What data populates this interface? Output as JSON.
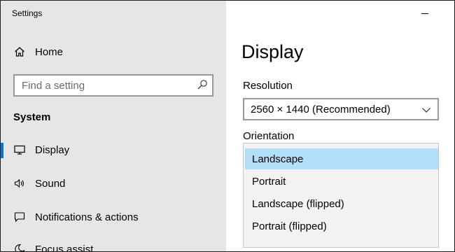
{
  "window": {
    "title": "Settings"
  },
  "sidebar": {
    "home_label": "Home",
    "search_placeholder": "Find a setting",
    "section_title": "System",
    "items": [
      {
        "label": "Display",
        "icon": "monitor-icon",
        "selected": true
      },
      {
        "label": "Sound",
        "icon": "speaker-icon",
        "selected": false
      },
      {
        "label": "Notifications & actions",
        "icon": "message-icon",
        "selected": false
      },
      {
        "label": "Focus assist",
        "icon": "moon-icon",
        "selected": false
      }
    ]
  },
  "main": {
    "page_title": "Display",
    "resolution": {
      "label": "Resolution",
      "value": "2560 × 1440 (Recommended)"
    },
    "orientation": {
      "label": "Orientation",
      "options": [
        {
          "label": "Landscape",
          "selected": true
        },
        {
          "label": "Portrait",
          "selected": false
        },
        {
          "label": "Landscape (flipped)",
          "selected": false
        },
        {
          "label": "Portrait (flipped)",
          "selected": false
        }
      ]
    }
  },
  "colors": {
    "accent": "#0078d7",
    "sidebar_bg": "#e6e6e6",
    "dropdown_bg": "#f2f2f2",
    "option_selected_bg": "#b3def7"
  }
}
